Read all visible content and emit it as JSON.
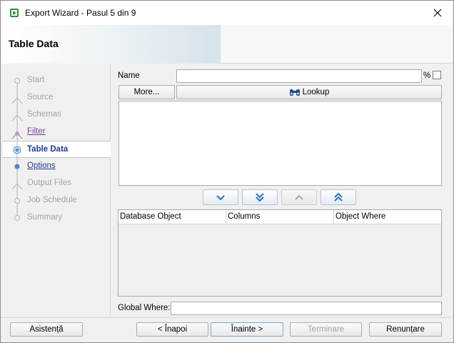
{
  "window": {
    "title": "Export Wizard - Pasul 5 din 9"
  },
  "header": {
    "title": "Table Data"
  },
  "steps": [
    {
      "label": "Start",
      "state": "disabled"
    },
    {
      "label": "Source",
      "state": "disabled"
    },
    {
      "label": "Schemas",
      "state": "disabled"
    },
    {
      "label": "Filter",
      "state": "visited"
    },
    {
      "label": "Table Data",
      "state": "current"
    },
    {
      "label": "Options",
      "state": "link"
    },
    {
      "label": "Output Files",
      "state": "disabled"
    },
    {
      "label": "Job Schedule",
      "state": "disabled"
    },
    {
      "label": "Summary",
      "state": "disabled"
    }
  ],
  "form": {
    "name_label": "Name",
    "name_value": "",
    "percent": "%",
    "more_label": "More...",
    "lookup_label": "Lookup",
    "global_where_label": "Global Where:",
    "global_where_value": ""
  },
  "table": {
    "columns": [
      "Database Object",
      "Columns",
      "Object Where"
    ],
    "rows": []
  },
  "footer": {
    "help": "Asistență",
    "back": "< Înapoi",
    "next": "Înainte >",
    "finish": "Terminare",
    "cancel": "Renunțare"
  },
  "icons": {
    "move_down": "chevron-down-icon",
    "move_all_down": "double-chevron-down-icon",
    "move_up": "chevron-up-icon",
    "move_all_up": "double-chevron-up-icon",
    "lookup": "binoculars-icon",
    "close": "close-icon"
  },
  "colors": {
    "link": "#1f3b8f",
    "visited": "#7a3f98",
    "disabled": "#a3a3a3",
    "arrow": "#2a6fc4"
  }
}
